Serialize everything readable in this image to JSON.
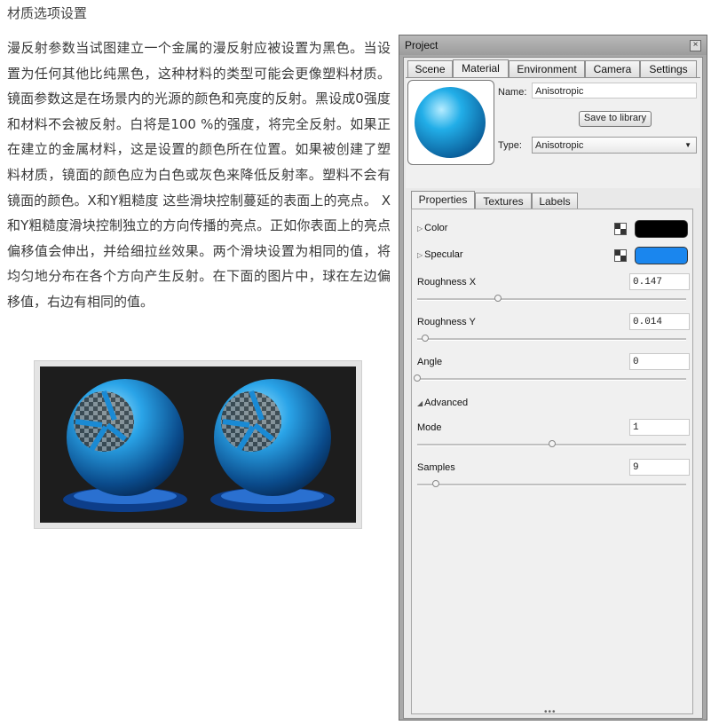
{
  "article": {
    "heading": "材质选项设置",
    "paragraph": "漫反射参数当试图建立一个金属的漫反射应被设置为黑色。当设置为任何其他比纯黑色，这种材料的类型可能会更像塑料材质。镜面参数这是在场景内的光源的颜色和亮度的反射。黑设成0强度和材料不会被反射。白将是100 %的强度，将完全反射。如果正在建立的金属材料，这是设置的颜色所在位置。如果被创建了塑料材质，镜面的颜色应为白色或灰色来降低反射率。塑料不会有镜面的颜色。X和Y粗糙度 这些滑块控制蔓延的表面上的亮点。 X和Y粗糙度滑块控制独立的方向传播的亮点。正如你表面上的亮点偏移值会伸出，并给细拉丝效果。两个滑块设置为相同的值，将均匀地分布在各个方向产生反射。在下面的图片中，球在左边偏移值，右边有相同的值。"
  },
  "panel": {
    "title": "Project",
    "close_glyph": "×",
    "tabs": [
      "Scene",
      "Material",
      "Environment",
      "Camera",
      "Settings"
    ],
    "active_tab": "Material",
    "name_label": "Name:",
    "name_value": "Anisotropic",
    "save_button": "Save to library",
    "type_label": "Type:",
    "type_value": "Anisotropic",
    "subtabs": [
      "Properties",
      "Textures",
      "Labels"
    ],
    "active_subtab": "Properties",
    "color": {
      "label": "Color",
      "swatch": "#000000"
    },
    "specular": {
      "label": "Specular",
      "swatch": "#1a86ee"
    },
    "params": [
      {
        "label": "Roughness X",
        "value": "0.147",
        "level": 0.3
      },
      {
        "label": "Roughness Y",
        "value": "0.014",
        "level": 0.03
      },
      {
        "label": "Angle",
        "value": "0",
        "level": 0.0
      },
      {
        "label": "Mode",
        "value": "1",
        "level": 0.5
      },
      {
        "label": "Samples",
        "value": "9",
        "level": 0.07
      }
    ],
    "advanced_label": "Advanced",
    "grip_glyph": "•••"
  },
  "colors": {
    "accent_blue": "#1a86ee",
    "sphere_blue": "#1e9ad6"
  },
  "icons": {
    "expander_closed": "triangle-right-icon",
    "expander_open": "triangle-down-icon",
    "texture": "checker-texture-icon",
    "dropdown": "chevron-down-icon"
  }
}
